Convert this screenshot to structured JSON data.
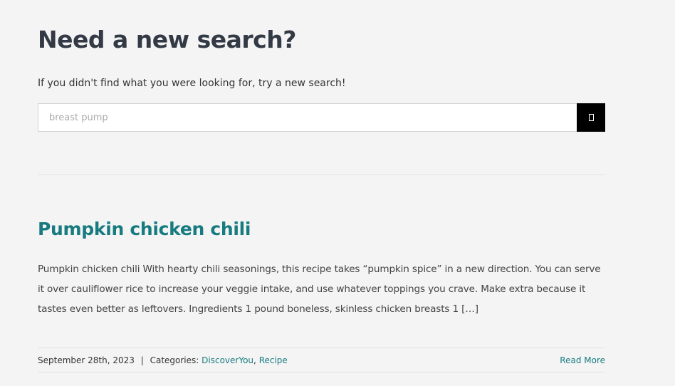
{
  "search": {
    "heading": "Need a new search?",
    "subtext": "If you didn't find what you were looking for, try a new search!",
    "query_value": "breast pump",
    "button_icon": "search-icon"
  },
  "post": {
    "title": "Pumpkin chicken chili",
    "excerpt": "Pumpkin chicken chili With hearty chili seasonings, this recipe takes “pumpkin spice” in a new direction. You can serve it over cauliflower rice to increase your veggie intake, and use whatever toppings you crave. Make extra because it tastes even better as leftovers. Ingredients 1 pound boneless, skinless chicken breasts 1 […]",
    "meta": {
      "date": "September 28th, 2023",
      "separator": "|",
      "categories_label": "Categories:",
      "categories": [
        "DiscoverYou",
        "Recipe"
      ],
      "category_separator": ","
    },
    "read_more": "Read More"
  },
  "colors": {
    "background": "#f4f4f4",
    "heading": "#333a45",
    "link_accent": "#177b80",
    "button_bg": "#000000",
    "divider": "#e2e2e2"
  }
}
